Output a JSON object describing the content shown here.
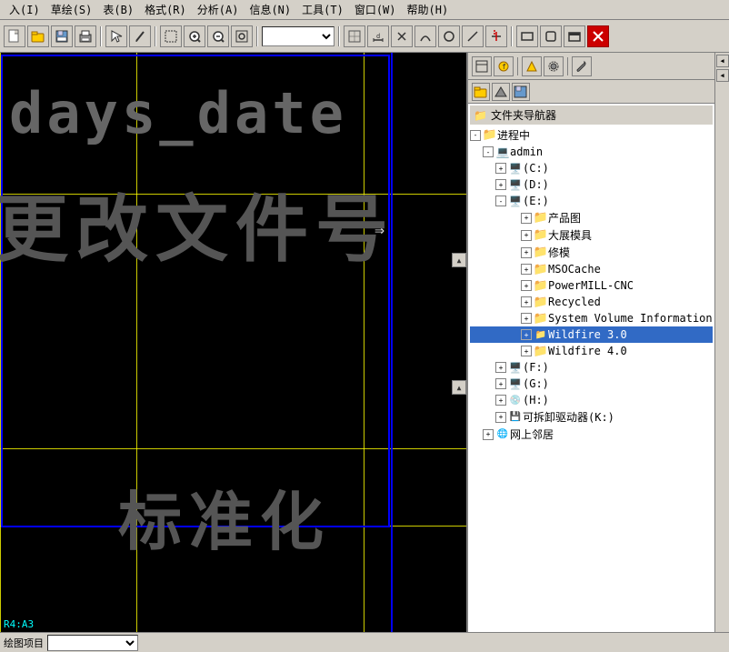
{
  "menubar": {
    "items": [
      "入(I)",
      "草绘(S)",
      "表(B)",
      "格式(R)",
      "分析(A)",
      "信息(N)",
      "工具(T)",
      "窗口(W)",
      "帮助(H)"
    ]
  },
  "toolbar": {
    "buttons": [
      "new",
      "open",
      "save",
      "print",
      "cursor",
      "zoom-in",
      "zoom-out",
      "zoom-window",
      "zoom-fit",
      "select",
      "move",
      "rotate",
      "pan",
      "cut",
      "copy",
      "paste",
      "delete",
      "combo"
    ]
  },
  "drawing": {
    "text1": "days_date",
    "text2": "更改文件号",
    "text3": "标准化",
    "status": "R4:A3"
  },
  "right_panel": {
    "header": "文件夹导航器",
    "tree": {
      "root": "进程中",
      "computer": "admin",
      "drives": [
        {
          "label": "(C:)",
          "expanded": false,
          "children": []
        },
        {
          "label": "(D:)",
          "expanded": false,
          "children": []
        },
        {
          "label": "(E:)",
          "expanded": true,
          "children": [
            {
              "label": "产品图",
              "type": "folder"
            },
            {
              "label": "大展模具",
              "type": "folder"
            },
            {
              "label": "修模",
              "type": "folder"
            },
            {
              "label": "MSOCache",
              "type": "folder"
            },
            {
              "label": "PowerMILL-CNC",
              "type": "folder"
            },
            {
              "label": "Recycled",
              "type": "folder"
            },
            {
              "label": "System Volume Information",
              "type": "folder"
            },
            {
              "label": "Wildfire 3.0",
              "type": "folder",
              "selected": true
            },
            {
              "label": "Wildfire 4.0",
              "type": "folder"
            }
          ]
        },
        {
          "label": "(F:)",
          "expanded": false,
          "children": []
        },
        {
          "label": "(G:)",
          "expanded": false,
          "children": []
        },
        {
          "label": "(H:)",
          "expanded": false,
          "children": []
        },
        {
          "label": "可拆卸驱动器(K:)",
          "expanded": false,
          "children": []
        }
      ],
      "network": "网上邻居"
    }
  },
  "status_bar": {
    "label": "绘图项目",
    "combo_value": ""
  }
}
